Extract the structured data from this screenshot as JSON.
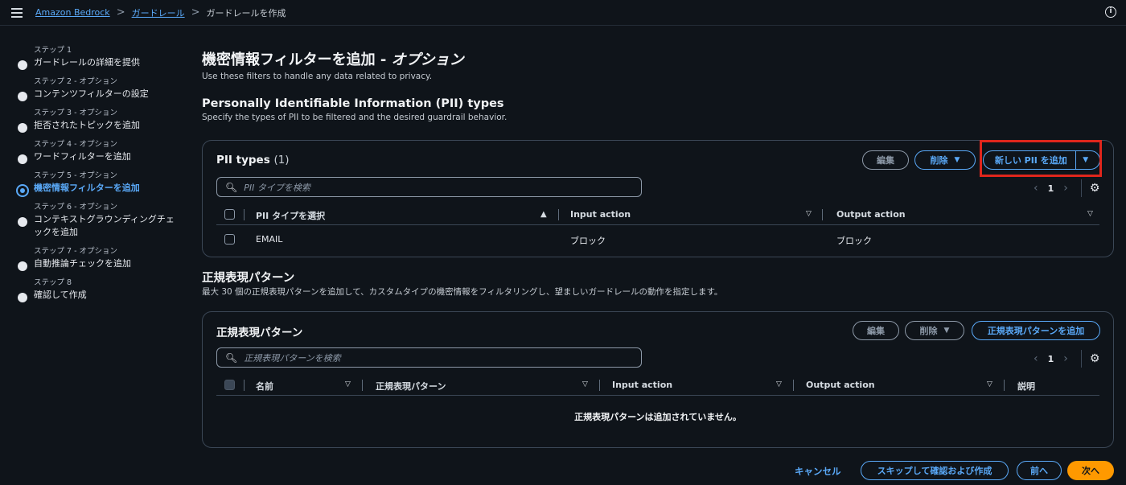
{
  "breadcrumb": {
    "home": "Amazon Bedrock",
    "guardrails": "ガードレール",
    "current": "ガードレールを作成",
    "separator": ">"
  },
  "steps": [
    {
      "num": "ステップ 1",
      "title": "ガードレールの詳細を提供",
      "state": "default"
    },
    {
      "num": "ステップ 2 - オプション",
      "title": "コンテンツフィルターの設定",
      "state": "default"
    },
    {
      "num": "ステップ 3 - オプション",
      "title": "拒否されたトピックを追加",
      "state": "default"
    },
    {
      "num": "ステップ 4 - オプション",
      "title": "ワードフィルターを追加",
      "state": "default"
    },
    {
      "num": "ステップ 5 - オプション",
      "title": "機密情報フィルターを追加",
      "state": "active"
    },
    {
      "num": "ステップ 6 - オプション",
      "title": "コンテキストグラウンディングチェックを追加",
      "title_line1": "コンテキストグラウンディングチェ",
      "title_line2": "ックを追加",
      "state": "default"
    },
    {
      "num": "ステップ 7 - オプション",
      "title": "自動推論チェックを追加",
      "state": "default"
    },
    {
      "num": "ステップ 8",
      "title": "確認して作成",
      "state": "default"
    }
  ],
  "header": {
    "title_main": "機密情報フィルターを追加 - ",
    "title_italic": "オプション",
    "description": "Use these filters to handle any data related to privacy."
  },
  "pii_section": {
    "title": "Personally Identifiable Information (PII) types",
    "description": "Specify the types of PII to be filtered and the desired guardrail behavior."
  },
  "pii_panel": {
    "title": "PII types",
    "count": "(1)",
    "edit_label": "編集",
    "delete_label": "削除",
    "add_label": "新しい PII を追加",
    "search_placeholder": "PII タイプを検索",
    "page": "1",
    "columns": [
      "PII タイプを選択",
      "Input action",
      "Output action"
    ],
    "rows": [
      {
        "type": "EMAIL",
        "input": "ブロック",
        "output": "ブロック"
      }
    ]
  },
  "regex_section": {
    "title": "正規表現パターン",
    "description": "最大 30 個の正規表現パターンを追加して、カスタムタイプの機密情報をフィルタリングし、望ましいガードレールの動作を指定します。"
  },
  "regex_panel": {
    "title": "正規表現パターン",
    "edit_label": "編集",
    "delete_label": "削除",
    "add_label": "正規表現パターンを追加",
    "search_placeholder": "正規表現パターンを検索",
    "page": "1",
    "columns": [
      "名前",
      "正規表現パターン",
      "Input action",
      "Output action",
      "説明"
    ],
    "empty_text": "正規表現パターンは追加されていません。"
  },
  "footer": {
    "cancel_label": "キャンセル",
    "skip_label": "スキップして確認および作成",
    "prev_label": "前へ",
    "next_label": "次へ"
  },
  "colors": {
    "background": "#0f141a",
    "link": "#5aa9f8",
    "primary": "#ff9900",
    "highlight": "#e0261c"
  }
}
